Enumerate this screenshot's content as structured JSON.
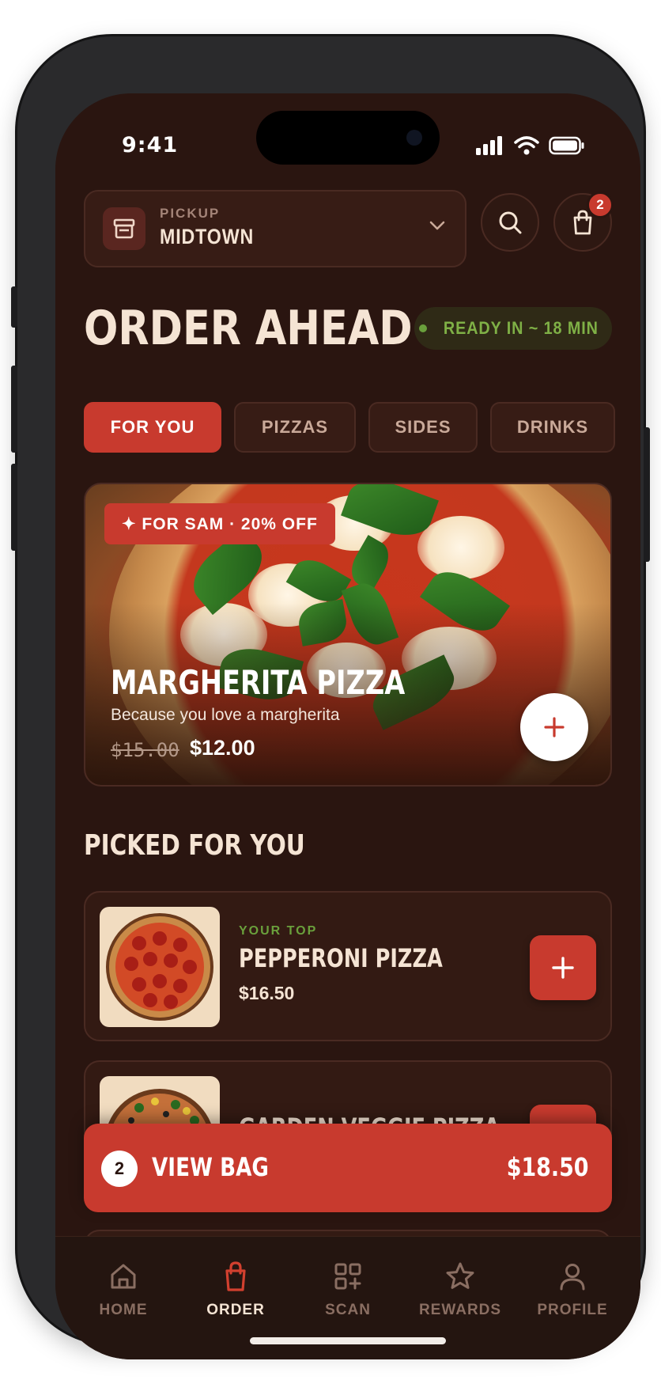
{
  "status": {
    "time": "9:41"
  },
  "pickup": {
    "label": "PICKUP",
    "location": "MIDTOWN"
  },
  "cart": {
    "badge_count": "2"
  },
  "page": {
    "title": "ORDER AHEAD",
    "ready_text": "READY IN ~ 18 MIN"
  },
  "tabs": [
    {
      "label": "FOR YOU",
      "active": true
    },
    {
      "label": "PIZZAS"
    },
    {
      "label": "SIDES"
    },
    {
      "label": "DRINKS"
    }
  ],
  "featured": {
    "promo": "✦ FOR SAM · 20% OFF",
    "name": "MARGHERITA PIZZA",
    "subtitle": "Because you love a margherita",
    "old_price": "$15.00",
    "price": "$12.00"
  },
  "section_title": "PICKED FOR YOU",
  "items": [
    {
      "tag": "YOUR TOP",
      "name": "PEPPERONI PIZZA",
      "price": "$16.50"
    },
    {
      "name": "GARDEN VEGGIE PIZZA"
    }
  ],
  "bag": {
    "count": "2",
    "label": "VIEW BAG",
    "total": "$18.50"
  },
  "nav": [
    {
      "label": "HOME",
      "icon": "home-icon"
    },
    {
      "label": "ORDER",
      "icon": "shopping-bag-icon",
      "active": true
    },
    {
      "label": "SCAN",
      "icon": "qr-scan-icon"
    },
    {
      "label": "REWARDS",
      "icon": "star-icon"
    },
    {
      "label": "PROFILE",
      "icon": "person-icon"
    }
  ],
  "colors": {
    "accent": "#c83a2e",
    "background": "#2a1510",
    "ready_green": "#7fb046"
  }
}
